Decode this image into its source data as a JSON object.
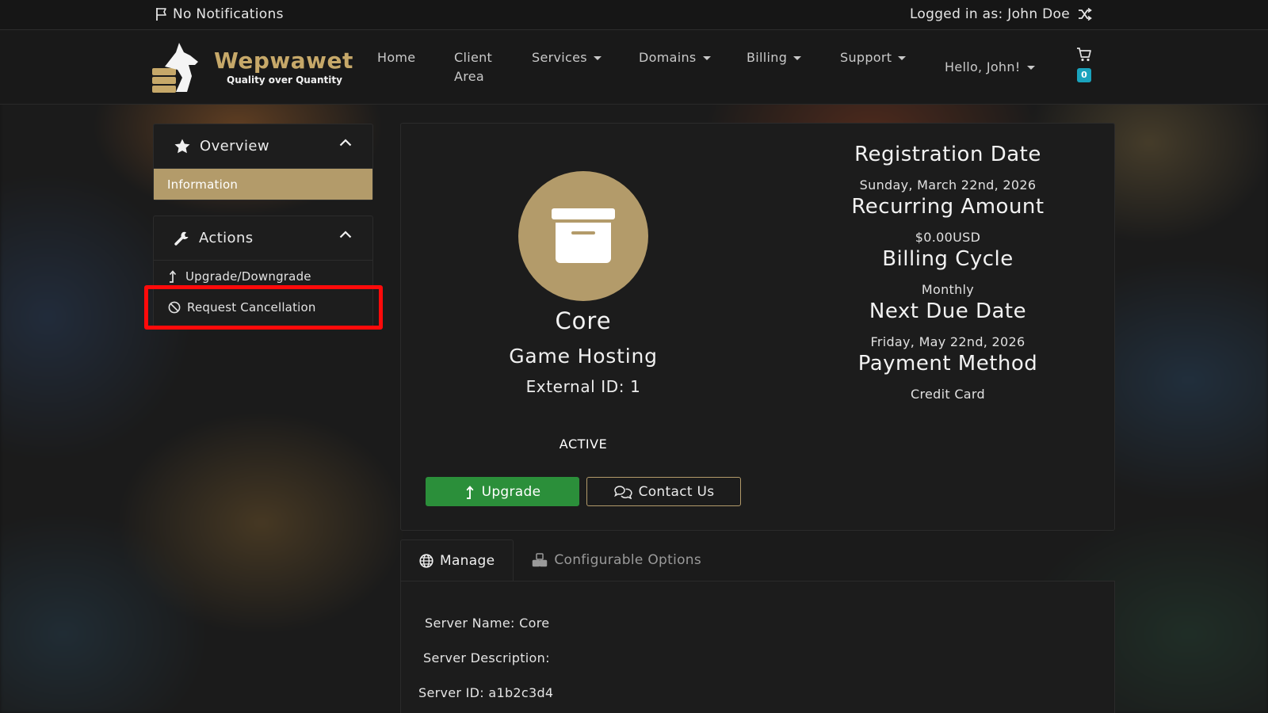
{
  "topbar": {
    "notifications": "No Notifications",
    "logged_in": "Logged in as: John Doe"
  },
  "brand": {
    "name": "Wepwawet",
    "tagline": "Quality over Quantity"
  },
  "nav": {
    "home": "Home",
    "client_area_line1": "Client",
    "client_area_line2": "Area",
    "services": "Services",
    "domains": "Domains",
    "billing": "Billing",
    "support": "Support",
    "hello": "Hello, John!",
    "cart_count": "0"
  },
  "sidebar": {
    "overview": {
      "title": "Overview",
      "items": [
        {
          "label": "Information"
        }
      ]
    },
    "actions": {
      "title": "Actions",
      "items": [
        {
          "label": "Upgrade/Downgrade"
        },
        {
          "label": "Request Cancellation"
        }
      ]
    }
  },
  "product": {
    "name": "Core",
    "group": "Game Hosting",
    "external_id": "External ID: 1",
    "status": "ACTIVE",
    "upgrade_label": "Upgrade",
    "contact_label": "Contact Us"
  },
  "details": {
    "registration_title": "Registration Date",
    "registration_value": "Sunday, March 22nd, 2026",
    "recurring_title": "Recurring Amount",
    "recurring_value": "$0.00USD",
    "cycle_title": "Billing Cycle",
    "cycle_value": "Monthly",
    "due_title": "Next Due Date",
    "due_value": "Friday, May 22nd, 2026",
    "payment_title": "Payment Method",
    "payment_value": "Credit Card"
  },
  "tabs": {
    "manage": "Manage",
    "configurable": "Configurable Options"
  },
  "manage": {
    "server_name": "Server Name: Core",
    "server_description": "Server Description:",
    "server_id": "Server ID: a1b2c3d4"
  },
  "colors": {
    "accent_gold": "#b39b6a",
    "upgrade_green": "#2b8f3a",
    "badge_teal": "#1aa3bd",
    "highlight_red": "#ff0a0a"
  }
}
